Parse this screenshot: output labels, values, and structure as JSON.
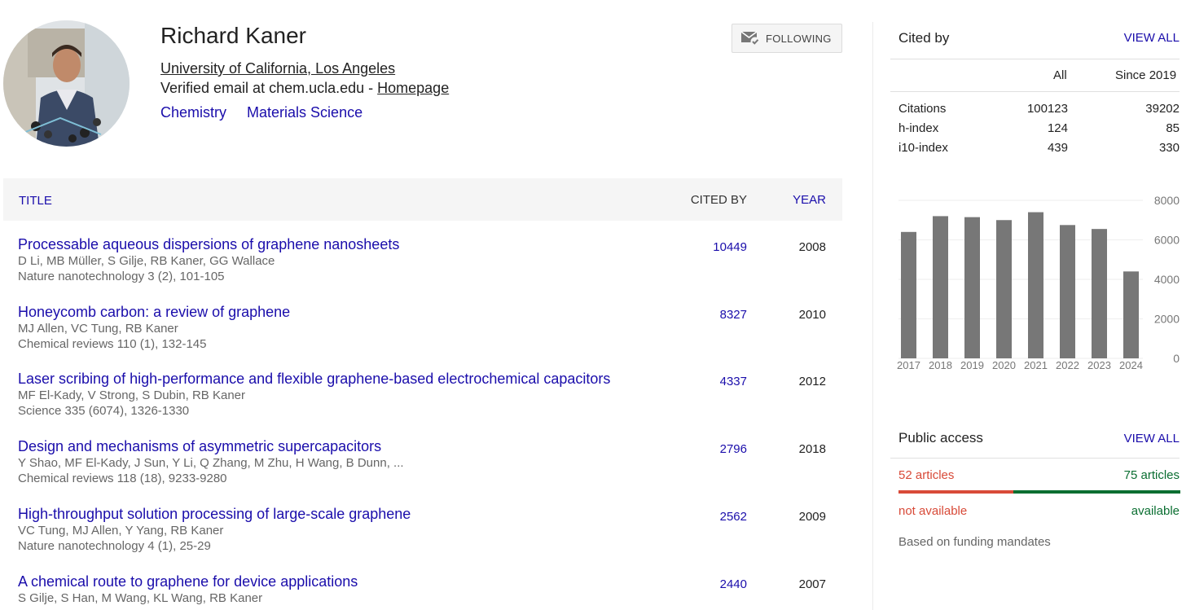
{
  "profile": {
    "name": "Richard Kaner",
    "affiliation": "University of California, Los Angeles",
    "email_text": "Verified email at chem.ucla.edu - ",
    "homepage_label": "Homepage",
    "interests": [
      "Chemistry",
      "Materials Science"
    ],
    "follow_label": "FOLLOWING"
  },
  "table": {
    "headers": {
      "title": "TITLE",
      "cited_by": "CITED BY",
      "year": "YEAR"
    },
    "rows": [
      {
        "title": "Processable aqueous dispersions of graphene nanosheets",
        "authors": "D Li, MB Müller, S Gilje, RB Kaner, GG Wallace",
        "venue": "Nature nanotechnology 3 (2), 101-105",
        "cited_by": "10449",
        "year": "2008"
      },
      {
        "title": "Honeycomb carbon: a review of graphene",
        "authors": "MJ Allen, VC Tung, RB Kaner",
        "venue": "Chemical reviews 110 (1), 132-145",
        "cited_by": "8327",
        "year": "2010"
      },
      {
        "title": "Laser scribing of high-performance and flexible graphene-based electrochemical capacitors",
        "authors": "MF El-Kady, V Strong, S Dubin, RB Kaner",
        "venue": "Science 335 (6074), 1326-1330",
        "cited_by": "4337",
        "year": "2012"
      },
      {
        "title": "Design and mechanisms of asymmetric supercapacitors",
        "authors": "Y Shao, MF El-Kady, J Sun, Y Li, Q Zhang, M Zhu, H Wang, B Dunn, ...",
        "venue": "Chemical reviews 118 (18), 9233-9280",
        "cited_by": "2796",
        "year": "2018"
      },
      {
        "title": "High-throughput solution processing of large-scale graphene",
        "authors": "VC Tung, MJ Allen, Y Yang, RB Kaner",
        "venue": "Nature nanotechnology 4 (1), 25-29",
        "cited_by": "2562",
        "year": "2009"
      },
      {
        "title": "A chemical route to graphene for device applications",
        "authors": "S Gilje, S Han, M Wang, KL Wang, RB Kaner",
        "venue": "",
        "cited_by": "2440",
        "year": "2007"
      }
    ]
  },
  "cited_by": {
    "heading": "Cited by",
    "view_all": "VIEW ALL",
    "col_all": "All",
    "col_since": "Since 2019",
    "stats": [
      {
        "label": "Citations",
        "all": "100123",
        "since": "39202"
      },
      {
        "label": "h-index",
        "all": "124",
        "since": "85"
      },
      {
        "label": "i10-index",
        "all": "439",
        "since": "330"
      }
    ]
  },
  "chart_data": {
    "type": "bar",
    "categories": [
      "2017",
      "2018",
      "2019",
      "2020",
      "2021",
      "2022",
      "2023",
      "2024"
    ],
    "values": [
      6400,
      7200,
      7150,
      7000,
      7400,
      6750,
      6550,
      4400
    ],
    "ylim": [
      0,
      8000
    ],
    "yticks": [
      "0",
      "2000",
      "4000",
      "6000",
      "8000"
    ],
    "bar_color": "#777777",
    "grid": true
  },
  "public_access": {
    "heading": "Public access",
    "view_all": "VIEW ALL",
    "not_available_count": "52 articles",
    "available_count": "75 articles",
    "not_available_label": "not available",
    "available_label": "available",
    "note": "Based on funding mandates",
    "red": "#d84a38",
    "green": "#0a6e31"
  }
}
